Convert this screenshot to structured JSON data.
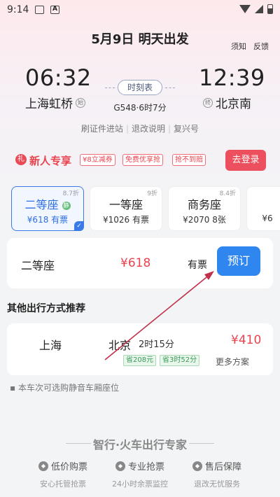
{
  "status_bar": {
    "time": "9:14",
    "img_icon": "image-icon",
    "a_icon": "A"
  },
  "header": {
    "title": "5月9日 明天出发",
    "notice": "须知",
    "feedback": "反馈"
  },
  "train": {
    "dep_time": "06:32",
    "arr_time": "12:39",
    "dep_station": "上海虹桥",
    "dep_badge": "始",
    "arr_station": "北京南",
    "arr_badge": "终",
    "schedule_label": "时刻表",
    "info": "G548·6时7分",
    "links": [
      "刷证件进站",
      "退改说明",
      "复兴号"
    ]
  },
  "promo": {
    "icon": "礼",
    "title": "新人专享",
    "tags": [
      "¥8立减券",
      "免费优享抢",
      "抢不到赔"
    ],
    "login": "去登录"
  },
  "seats": [
    {
      "name": "二等座",
      "discount": "8.7折",
      "price": "¥618",
      "avail": "有票",
      "badge": "静",
      "active": true
    },
    {
      "name": "一等座",
      "discount": "9折",
      "price": "¥1026",
      "avail": "有票",
      "active": false
    },
    {
      "name": "商务座",
      "discount": "8.4折",
      "price": "¥2070",
      "avail": "8张",
      "active": false
    },
    {
      "name": "",
      "discount": "",
      "price": "¥6",
      "avail": "",
      "active": false
    }
  ],
  "booking": {
    "seat": "二等座",
    "price": "¥618",
    "avail": "有票",
    "button": "预订"
  },
  "recommend": {
    "title": "其他出行方式推荐",
    "from": "上海",
    "to": "北京",
    "duration": "2时15分",
    "price": "¥410",
    "tags": [
      "省208元",
      "省3时52分"
    ],
    "more": "更多方案"
  },
  "note": "本车次可选购静音车厢座位",
  "footer": {
    "title": "智行·火车出行专家",
    "features": [
      {
        "icon": "shield-icon",
        "title": "低价购票",
        "sub": "安心托管抢票"
      },
      {
        "icon": "bag-icon",
        "title": "专业抢票",
        "sub": "24小时余票监控"
      },
      {
        "icon": "shield-icon",
        "title": "售后保障",
        "sub": "退改无忧服务"
      }
    ]
  },
  "colors": {
    "accent_red": "#e9434f",
    "accent_blue": "#2f86ee"
  }
}
